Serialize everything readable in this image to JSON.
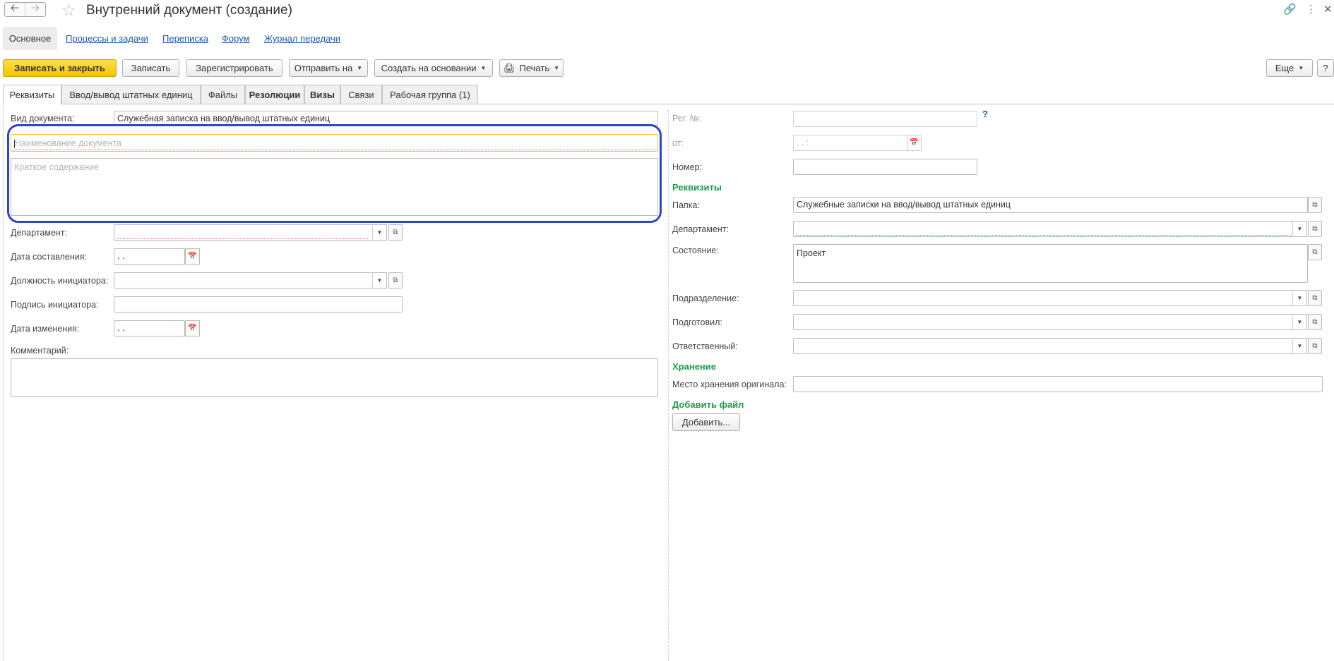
{
  "window": {
    "title": "Внутренний документ (создание)",
    "icons": [
      "arrow-left-icon",
      "arrow-right-icon",
      "star-icon",
      "link-icon",
      "more-vert-icon",
      "close-icon"
    ]
  },
  "sections": {
    "active": "Основное",
    "links": [
      "Процессы и задачи",
      "Переписка",
      "Форум",
      "Журнал передачи"
    ]
  },
  "toolbar": {
    "save_close": "Записать и закрыть",
    "save": "Записать",
    "register": "Зарегистрировать",
    "send": "Отправить на",
    "create_based": "Создать на основании",
    "print": "Печать",
    "more": "Еще",
    "help": "?"
  },
  "tabs": [
    "Реквизиты",
    "Ввод/вывод штатных единиц",
    "Файлы",
    "Резолюции",
    "Визы",
    "Связи",
    "Рабочая группа (1)"
  ],
  "left": {
    "doc_type_label": "Вид документа:",
    "doc_type_value": "Служебная записка на ввод/вывод штатных единиц",
    "name_placeholder": "Наименование документа",
    "summary_placeholder": "Краткое содержание",
    "department_label": "Департамент:",
    "date_created_label": "Дата составления:",
    "date_mask": " .  .",
    "initiator_position_label": "Должность инициатора:",
    "initiator_signature_label": "Подпись инициатора:",
    "date_changed_label": "Дата изменения:",
    "comment_label": "Комментарий:"
  },
  "right": {
    "reg_no_label": "Рег. №:",
    "help_mark": "?",
    "from_label": "от:",
    "from_mask": " .  .        :",
    "number_label": "Номер:",
    "requisites_header": "Реквизиты",
    "folder_label": "Папка:",
    "folder_value": "Служебные записки на ввод/вывод штатных единиц",
    "department_label": "Департамент:",
    "state_label": "Состояние:",
    "state_value": "Проект",
    "subdivision_label": "Подразделение:",
    "prepared_label": "Подготовил:",
    "responsible_label": "Ответственный:",
    "storage_header": "Хранение",
    "storage_place_label": "Место хранения оригинала:",
    "add_file_header": "Добавить файл",
    "add_button": "Добавить..."
  }
}
